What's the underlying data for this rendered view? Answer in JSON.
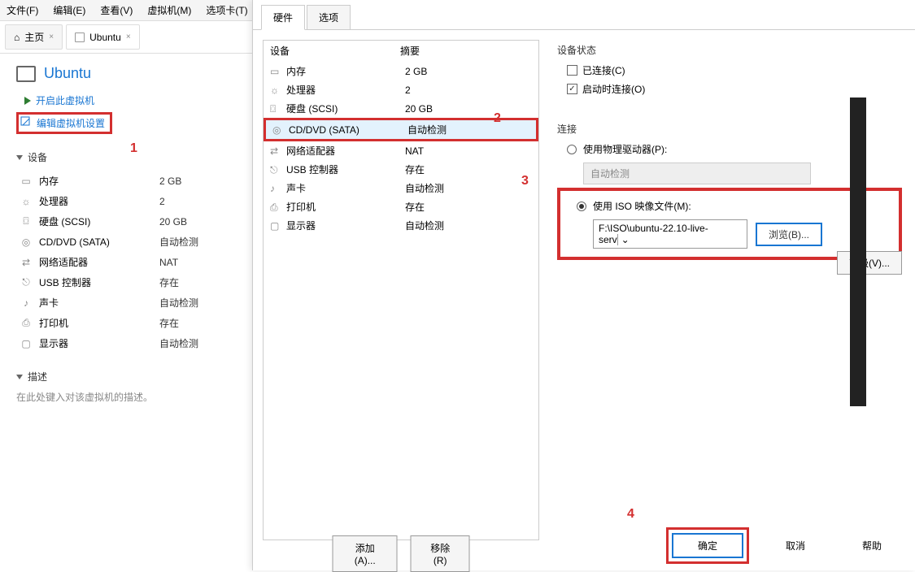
{
  "menubar": {
    "file": "文件(F)",
    "edit": "编辑(E)",
    "view": "查看(V)",
    "vm": "虚拟机(M)",
    "tabs": "选项卡(T)"
  },
  "tabs": {
    "home": "主页",
    "ubuntu": "Ubuntu"
  },
  "vm": {
    "title": "Ubuntu",
    "start": "开启此虚拟机",
    "edit_settings": "编辑虚拟机设置"
  },
  "annotations": {
    "a1": "1",
    "a2": "2",
    "a3": "3",
    "a4": "4"
  },
  "sidebar": {
    "devices_header": "设备",
    "desc_header": "描述",
    "desc_placeholder": "在此处键入对该虚拟机的描述。",
    "items": [
      {
        "label": "内存",
        "value": "2 GB"
      },
      {
        "label": "处理器",
        "value": "2"
      },
      {
        "label": "硬盘 (SCSI)",
        "value": "20 GB"
      },
      {
        "label": "CD/DVD (SATA)",
        "value": "自动检测"
      },
      {
        "label": "网络适配器",
        "value": "NAT"
      },
      {
        "label": "USB 控制器",
        "value": "存在"
      },
      {
        "label": "声卡",
        "value": "自动检测"
      },
      {
        "label": "打印机",
        "value": "存在"
      },
      {
        "label": "显示器",
        "value": "自动检测"
      }
    ]
  },
  "dialog": {
    "tab_hardware": "硬件",
    "tab_options": "选项",
    "col_device": "设备",
    "col_summary": "摘要",
    "hw": [
      {
        "label": "内存",
        "value": "2 GB"
      },
      {
        "label": "处理器",
        "value": "2"
      },
      {
        "label": "硬盘 (SCSI)",
        "value": "20 GB"
      },
      {
        "label": "CD/DVD (SATA)",
        "value": "自动检测"
      },
      {
        "label": "网络适配器",
        "value": "NAT"
      },
      {
        "label": "USB 控制器",
        "value": "存在"
      },
      {
        "label": "声卡",
        "value": "自动检测"
      },
      {
        "label": "打印机",
        "value": "存在"
      },
      {
        "label": "显示器",
        "value": "自动检测"
      }
    ],
    "add_btn": "添加(A)...",
    "remove_btn": "移除(R)",
    "device_status": "设备状态",
    "connected": "已连接(C)",
    "connect_at_start": "启动时连接(O)",
    "connection": "连接",
    "use_physical": "使用物理驱动器(P):",
    "auto_detect": "自动检测",
    "use_iso": "使用 ISO 映像文件(M):",
    "iso_path": "F:\\ISO\\ubuntu-22.10-live-serv",
    "browse": "浏览(B)...",
    "advanced": "高级(V)...",
    "ok": "确定",
    "cancel": "取消",
    "help": "帮助"
  }
}
